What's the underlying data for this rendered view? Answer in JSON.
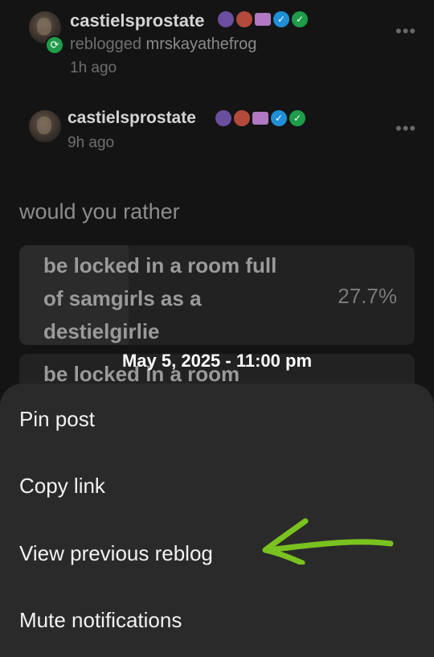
{
  "reblog_header": {
    "username": "castielsprostate",
    "reblogged_text": "reblogged",
    "reblogged_from": "mrskayathefrog",
    "time": "1h ago"
  },
  "post_header": {
    "username": "castielsprostate",
    "time": "9h ago"
  },
  "icons": [
    "more-icon",
    "reblog-icon",
    "verified-icon",
    "checkmark-badge-icon"
  ],
  "poll": {
    "question": "would you rather",
    "options": [
      {
        "label": "be locked in a room full of samgirls as a destielgirlie",
        "percent": "27.7%",
        "fill_fraction": 0.277
      },
      {
        "label": "be locked in a room"
      }
    ]
  },
  "timestamp": "May 5, 2025 - 11:00 pm",
  "menu": {
    "items": [
      "Pin post",
      "Copy link",
      "View previous reblog",
      "Mute notifications"
    ]
  },
  "colors": {
    "background": "#141414",
    "sheet": "#2a2a2a",
    "reblog_green": "#1f9c4a",
    "verified_blue": "#1f8fd6",
    "arrow_green": "#7ac21f"
  }
}
